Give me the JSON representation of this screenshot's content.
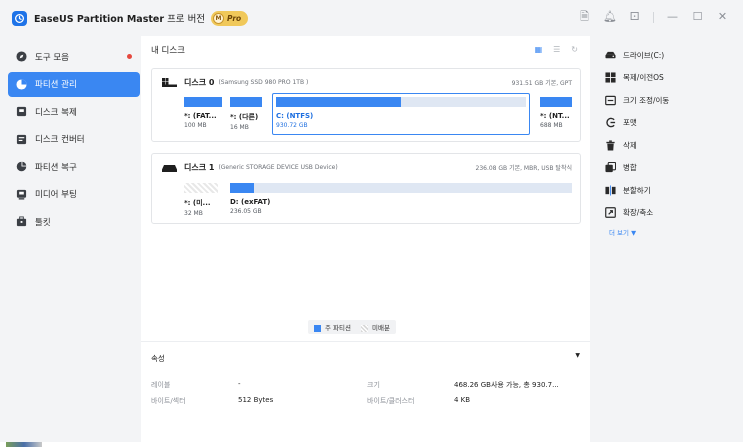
{
  "titlebar": {
    "app_name": "EaseUS Partition Master",
    "edition": " 프로 버전",
    "badge_letter": "M",
    "badge_text": "Pro"
  },
  "sidebar": {
    "items": [
      {
        "label": "도구 모음",
        "icon": "compass-icon",
        "active": false,
        "dot": true
      },
      {
        "label": "파티션 관리",
        "icon": "pie-chart-icon",
        "active": true,
        "dot": false
      },
      {
        "label": "디스크 복제",
        "icon": "clone-icon",
        "active": false,
        "dot": false
      },
      {
        "label": "디스크 컨버터",
        "icon": "convert-icon",
        "active": false,
        "dot": false
      },
      {
        "label": "파티션 복구",
        "icon": "recovery-icon",
        "active": false,
        "dot": false
      },
      {
        "label": "미디어 부팅",
        "icon": "media-icon",
        "active": false,
        "dot": false
      },
      {
        "label": "툴킷",
        "icon": "toolbox-icon",
        "active": false,
        "dot": false
      }
    ]
  },
  "main": {
    "title": "내 디스크",
    "disks": [
      {
        "name": "디스크 0",
        "model": "(Samsung SSD 980 PRO 1TB )",
        "info": "931.51 GB 기본, GPT",
        "partitions": [
          {
            "name": "*: (FAT...",
            "size": "100 MB",
            "used_fraction": 1.0
          },
          {
            "name": "*: (다른)",
            "size": "16 MB",
            "used_fraction": 1.0
          },
          {
            "name": "C: (NTFS)",
            "size": "930.72 GB",
            "used_fraction": 0.5,
            "selected": true
          },
          {
            "name": "*: (NT...",
            "size": "688 MB",
            "used_fraction": 1.0
          }
        ]
      },
      {
        "name": "디스크 1",
        "model": "(Generic  STORAGE DEVICE  USB Device)",
        "info": "236.08 GB 기본, MBR, USB 탈착식",
        "partitions": [
          {
            "name": "*: (미...",
            "size": "32 MB",
            "unallocated": true
          },
          {
            "name": "D: (exFAT)",
            "size": "236.05 GB",
            "used_fraction": 0.07
          }
        ]
      }
    ],
    "legend": {
      "primary": "주 파티션",
      "unallocated": "미배분"
    }
  },
  "properties": {
    "title": "속성",
    "rows": [
      {
        "label": "레이블",
        "value": "-"
      },
      {
        "label": "바이트/섹터",
        "value": "512 Bytes"
      },
      {
        "label": "크기",
        "value": "468.26 GB사용 가능, 총 930.7..."
      },
      {
        "label": "바이트/클러스터",
        "value": "4 KB"
      }
    ]
  },
  "operations": {
    "items": [
      {
        "label": "드라이브(C:)",
        "icon": "drive-icon"
      },
      {
        "label": "복제/이전OS",
        "icon": "windows-icon"
      },
      {
        "label": "크기 조정/이동",
        "icon": "resize-icon"
      },
      {
        "label": "포맷",
        "icon": "format-icon"
      },
      {
        "label": "삭제",
        "icon": "trash-icon"
      },
      {
        "label": "병합",
        "icon": "merge-icon"
      },
      {
        "label": "분할하기",
        "icon": "split-icon"
      },
      {
        "label": "확장/축소",
        "icon": "extend-icon"
      }
    ],
    "more": "더 보기 ▼"
  },
  "colors": {
    "accent": "#3a87f2",
    "badge": "#f0c85a",
    "notification_dot": "#e5483e"
  }
}
